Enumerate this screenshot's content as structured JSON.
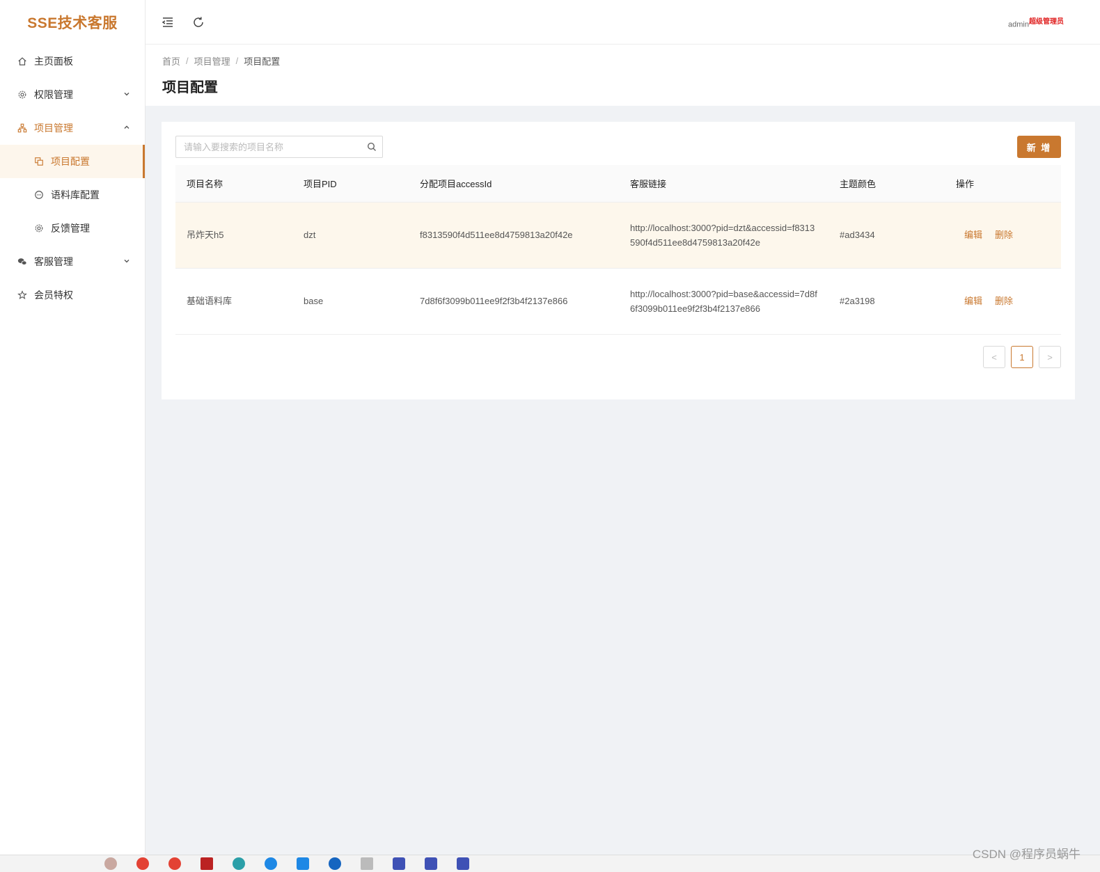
{
  "app": {
    "title": "SSE技术客服"
  },
  "sidebar": {
    "items": [
      {
        "label": "主页面板",
        "icon": "home-icon"
      },
      {
        "label": "权限管理",
        "icon": "gear-icon"
      },
      {
        "label": "项目管理",
        "icon": "org-icon"
      },
      {
        "label": "项目配置",
        "icon": "copy-icon"
      },
      {
        "label": "语料库配置",
        "icon": "chat-icon"
      },
      {
        "label": "反馈管理",
        "icon": "gear-icon"
      },
      {
        "label": "客服管理",
        "icon": "wechat-icon"
      },
      {
        "label": "会员特权",
        "icon": "star-icon"
      }
    ]
  },
  "header": {
    "user": "admin",
    "role": "超级管理员"
  },
  "breadcrumb": {
    "home": "首页",
    "parent": "项目管理",
    "current": "项目配置"
  },
  "page": {
    "title": "项目配置"
  },
  "search": {
    "placeholder": "请输入要搜索的项目名称",
    "value": ""
  },
  "toolbar": {
    "add_label": "新 增"
  },
  "table": {
    "headers": [
      "项目名称",
      "项目PID",
      "分配项目accessId",
      "客服链接",
      "主题颜色",
      "操作"
    ],
    "rows": [
      {
        "name": "吊炸天h5",
        "pid": "dzt",
        "accessid": "f8313590f4d511ee8d4759813a20f42e",
        "link": "http://localhost:3000?pid=dzt&accessid=f8313590f4d511ee8d4759813a20f42e",
        "color": "#ad3434",
        "edit": "编辑",
        "delete": "删除"
      },
      {
        "name": "基础语料库",
        "pid": "base",
        "accessid": "7d8f6f3099b011ee9f2f3b4f2137e866",
        "link": "http://localhost:3000?pid=base&accessid=7d8f6f3099b011ee9f2f3b4f2137e866",
        "color": "#2a3198",
        "edit": "编辑",
        "delete": "删除"
      }
    ]
  },
  "pagination": {
    "prev": "<",
    "current": "1",
    "next": ">"
  },
  "watermark": "CSDN @程序员蜗牛",
  "theme": {
    "accent": "#c9782f",
    "highlight_row": "#fdf7ec"
  }
}
